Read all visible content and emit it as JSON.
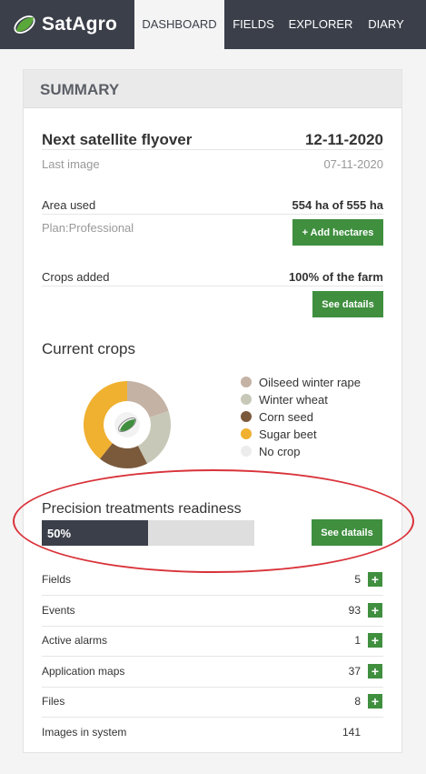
{
  "app": {
    "brand": "SatAgro"
  },
  "nav": {
    "items": [
      {
        "label": "DASHBOARD",
        "active": true
      },
      {
        "label": "FIELDS",
        "active": false
      },
      {
        "label": "EXPLORER",
        "active": false
      },
      {
        "label": "DIARY",
        "active": false
      }
    ]
  },
  "summary": {
    "title": "SUMMARY",
    "flyover": {
      "label": "Next satellite flyover",
      "value": "12-11-2020"
    },
    "last_image": {
      "label": "Last image",
      "value": "07-11-2020"
    },
    "area": {
      "label": "Area used",
      "value": "554 ha of 555 ha",
      "plan": "Plan:Professional",
      "button": "+ Add hectares"
    },
    "crops_added": {
      "label": "Crops added",
      "value": "100% of the farm",
      "button": "See datails"
    },
    "current_crops": {
      "label": "Current crops",
      "legend": [
        {
          "label": "Oilseed winter rape",
          "color": "#c4b2a4"
        },
        {
          "label": "Winter wheat",
          "color": "#c8c8b8"
        },
        {
          "label": "Corn seed",
          "color": "#7b5a3c"
        },
        {
          "label": "Sugar beet",
          "color": "#f0b030"
        },
        {
          "label": "No crop",
          "color": "#ececec"
        }
      ]
    },
    "precision": {
      "label": "Precision treatments readiness",
      "percent_label": "50%",
      "percent": 50,
      "button": "See datails"
    },
    "stats": [
      {
        "label": "Fields",
        "value": "5",
        "plus": true
      },
      {
        "label": "Events",
        "value": "93",
        "plus": true
      },
      {
        "label": "Active alarms",
        "value": "1",
        "plus": true
      },
      {
        "label": "Application maps",
        "value": "37",
        "plus": true
      },
      {
        "label": "Files",
        "value": "8",
        "plus": true
      },
      {
        "label": "Images in system",
        "value": "141",
        "plus": false
      }
    ]
  },
  "colors": {
    "nav_bg": "#3b3f4a",
    "accent_green": "#3f8f3f",
    "highlight_red": "#d9333a"
  }
}
